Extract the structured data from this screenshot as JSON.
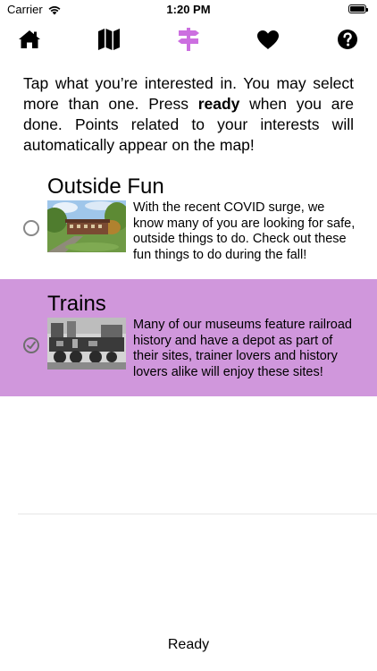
{
  "status_bar": {
    "carrier": "Carrier",
    "time": "1:20 PM"
  },
  "tabs": [
    {
      "name": "home",
      "icon": "home-icon"
    },
    {
      "name": "map",
      "icon": "map-icon"
    },
    {
      "name": "interests",
      "icon": "signpost-icon",
      "active": true
    },
    {
      "name": "favorites",
      "icon": "heart-icon"
    },
    {
      "name": "help",
      "icon": "question-icon"
    }
  ],
  "colors": {
    "accent": "#cc6fe0",
    "selected_row": "#d097dc"
  },
  "intro": {
    "part1": "Tap what you’re interested in. You may select more than one. Press ",
    "bold": "ready",
    "part2": " when you are done. Points related to your interests will automatically appear on the map!"
  },
  "interests": [
    {
      "title": "Outside Fun",
      "description": "With the recent COVID surge, we know many of you are looking for safe, outside things to do. Check out these fun things to do during the fall!",
      "selected": false
    },
    {
      "title": "Trains",
      "description": "Many of our museums feature railroad history and have a depot as part of their sites, trainer lovers and history lovers alike will enjoy these sites!",
      "selected": true
    }
  ],
  "ready_label": "Ready"
}
